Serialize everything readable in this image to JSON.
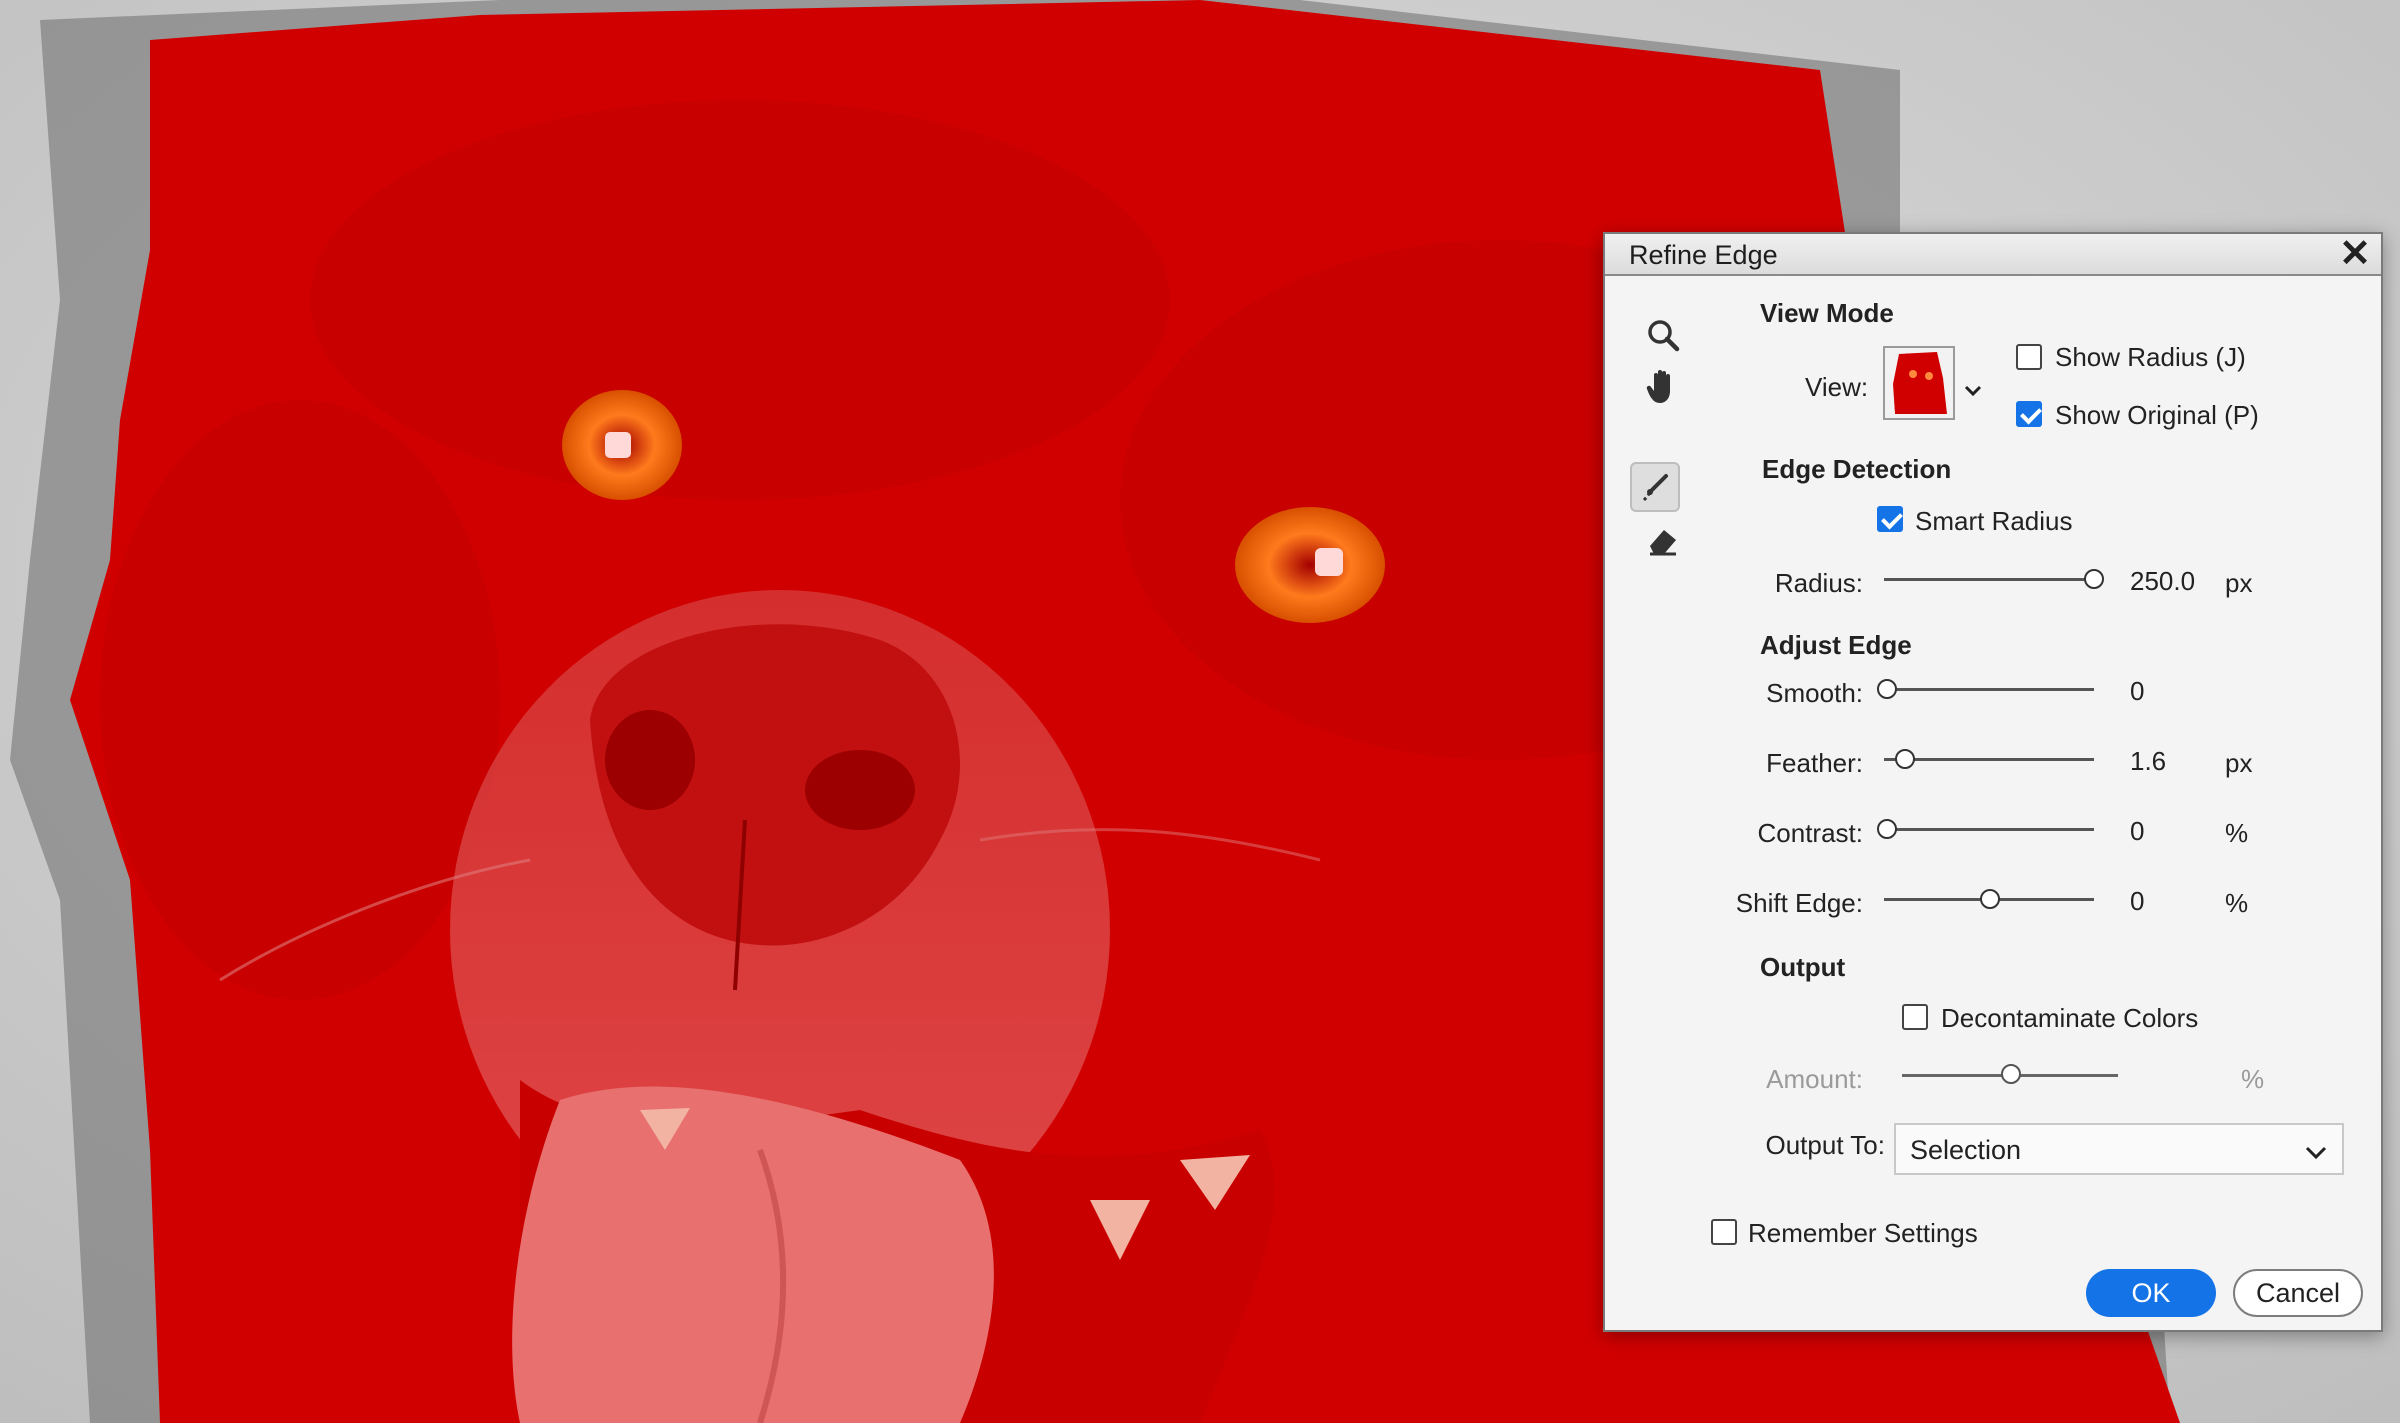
{
  "dialog": {
    "title": "Refine Edge",
    "close_glyph": "✕",
    "tools": [
      "zoom-tool",
      "hand-tool",
      "refine-radius-tool",
      "erase-refinements-tool"
    ],
    "view_mode": {
      "heading": "View Mode",
      "view_label": "View:",
      "show_radius": {
        "label": "Show Radius (J)",
        "checked": false
      },
      "show_original": {
        "label": "Show Original (P)",
        "checked": true
      }
    },
    "edge_detection": {
      "heading": "Edge Detection",
      "smart_radius": {
        "label": "Smart Radius",
        "checked": true
      },
      "radius": {
        "label": "Radius:",
        "value": "250.0",
        "unit": "px",
        "fraction": 1.0
      }
    },
    "adjust_edge": {
      "heading": "Adjust Edge",
      "smooth": {
        "label": "Smooth:",
        "value": "0",
        "unit": "",
        "fraction": 0
      },
      "feather": {
        "label": "Feather:",
        "value": "1.6",
        "unit": "px",
        "fraction": 0.06
      },
      "contrast": {
        "label": "Contrast:",
        "value": "0",
        "unit": "%",
        "fraction": 0
      },
      "shift_edge": {
        "label": "Shift Edge:",
        "value": "0",
        "unit": "%",
        "fraction": 0.5
      }
    },
    "output": {
      "heading": "Output",
      "decontaminate": {
        "label": "Decontaminate Colors",
        "checked": false
      },
      "amount": {
        "label": "Amount:",
        "unit": "%",
        "fraction": 0.5
      },
      "output_to_label": "Output To:",
      "output_to_value": "Selection"
    },
    "remember_settings": {
      "label": "Remember Settings",
      "checked": false
    },
    "ok_label": "OK",
    "cancel_label": "Cancel"
  },
  "colors": {
    "overlay_red": "#d10000",
    "accent_blue": "#1473e6",
    "background_gray": "#cfcfcf"
  }
}
